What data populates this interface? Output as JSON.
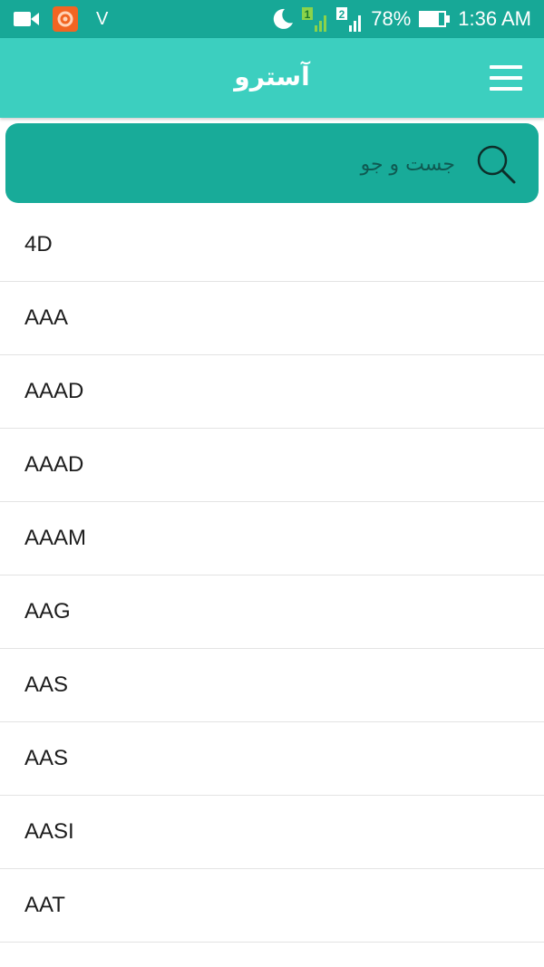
{
  "status_bar": {
    "left_letter": "V",
    "battery_percent": "78%",
    "time": "1:36 AM",
    "sim1_label": "1",
    "sim2_label": "2",
    "icons": [
      "video-camera-icon",
      "app-notification-icon",
      "moon-icon",
      "sim1-signal-icon",
      "sim2-signal-icon",
      "battery-icon"
    ]
  },
  "app_bar": {
    "title": "آسترو",
    "menu_icon": "hamburger-menu-icon"
  },
  "search": {
    "placeholder": "جست و جو",
    "value": "",
    "icon": "search-icon"
  },
  "list": {
    "items": [
      {
        "label": "4D"
      },
      {
        "label": "AAA"
      },
      {
        "label": "AAAD"
      },
      {
        "label": "AAAD"
      },
      {
        "label": "AAAM"
      },
      {
        "label": "AAG"
      },
      {
        "label": "AAS"
      },
      {
        "label": "AAS"
      },
      {
        "label": "AASI"
      },
      {
        "label": "AAT"
      }
    ]
  },
  "colors": {
    "status_bar": "#17a897",
    "app_bar": "#3ccfbf",
    "search_box": "#18ab99",
    "notification_icon": "#f26522"
  }
}
